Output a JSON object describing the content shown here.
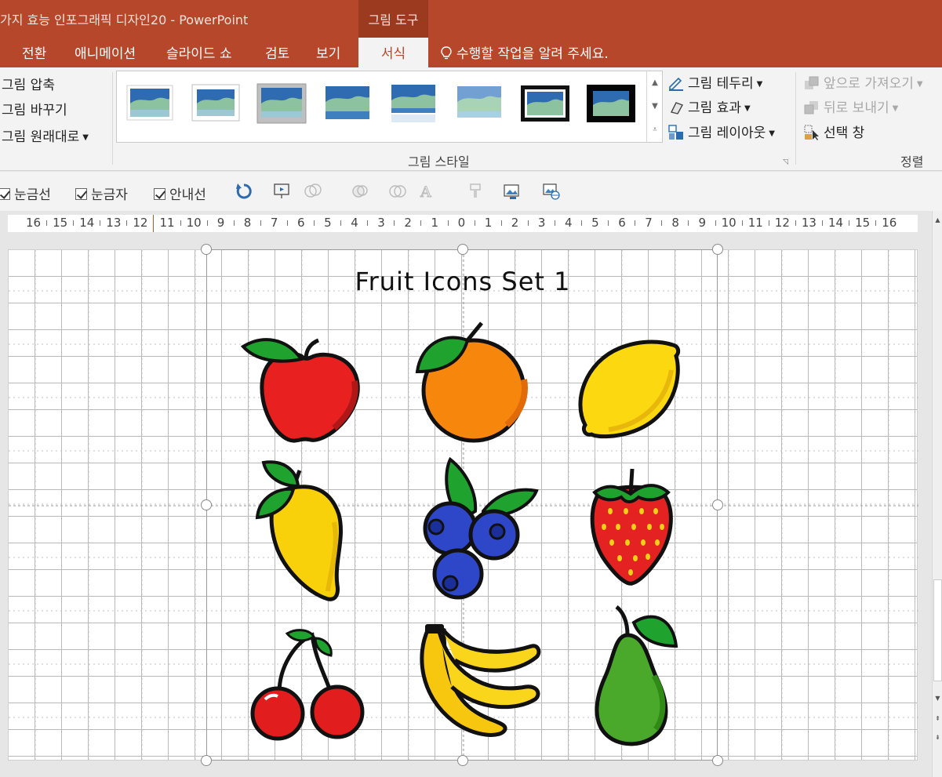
{
  "app": {
    "window_title": "가지 효능 인포그래픽 디자인20 - PowerPoint",
    "context_tab_group": "그림 도구"
  },
  "tabs": [
    {
      "label": "전환"
    },
    {
      "label": "애니메이션"
    },
    {
      "label": "슬라이드 쇼"
    },
    {
      "label": "검토"
    },
    {
      "label": "보기"
    },
    {
      "label": "서식",
      "active": true
    }
  ],
  "tell_me": "수행할 작업을 알려 주세요.",
  "ribbon": {
    "adjust": [
      "그림 압축",
      "그림 바꾸기",
      "그림 원래대로"
    ],
    "picture_styles_label": "그림 스타일",
    "style_options": [
      "그림 테두리",
      "그림 효과",
      "그림 레이아웃"
    ],
    "arrange": [
      "앞으로 가져오기",
      "뒤로 보내기",
      "선택 창"
    ],
    "arrange_label": "정렬"
  },
  "view_options": [
    "눈금선",
    "눈금자",
    "안내선"
  ],
  "ruler": {
    "labels": [
      "16",
      "15",
      "14",
      "13",
      "12",
      "11",
      "10",
      "9",
      "8",
      "7",
      "6",
      "5",
      "4",
      "3",
      "2",
      "1",
      "0",
      "1",
      "2",
      "3",
      "4",
      "5",
      "6",
      "7",
      "8",
      "9",
      "10",
      "11",
      "12",
      "13",
      "14",
      "15",
      "16"
    ]
  },
  "slide": {
    "picture_title": "Fruit Icons Set  1",
    "fruits": [
      "apple-icon",
      "orange-icon",
      "lemon-icon",
      "mango-icon",
      "blueberry-icon",
      "strawberry-icon",
      "cherry-icon",
      "banana-icon",
      "pear-icon"
    ]
  },
  "colors": {
    "accent": "#b7472a",
    "context_group": "#9c3a20",
    "ribbon_bg": "#f3f3f3",
    "canvas_bg": "#e6e6e6"
  }
}
